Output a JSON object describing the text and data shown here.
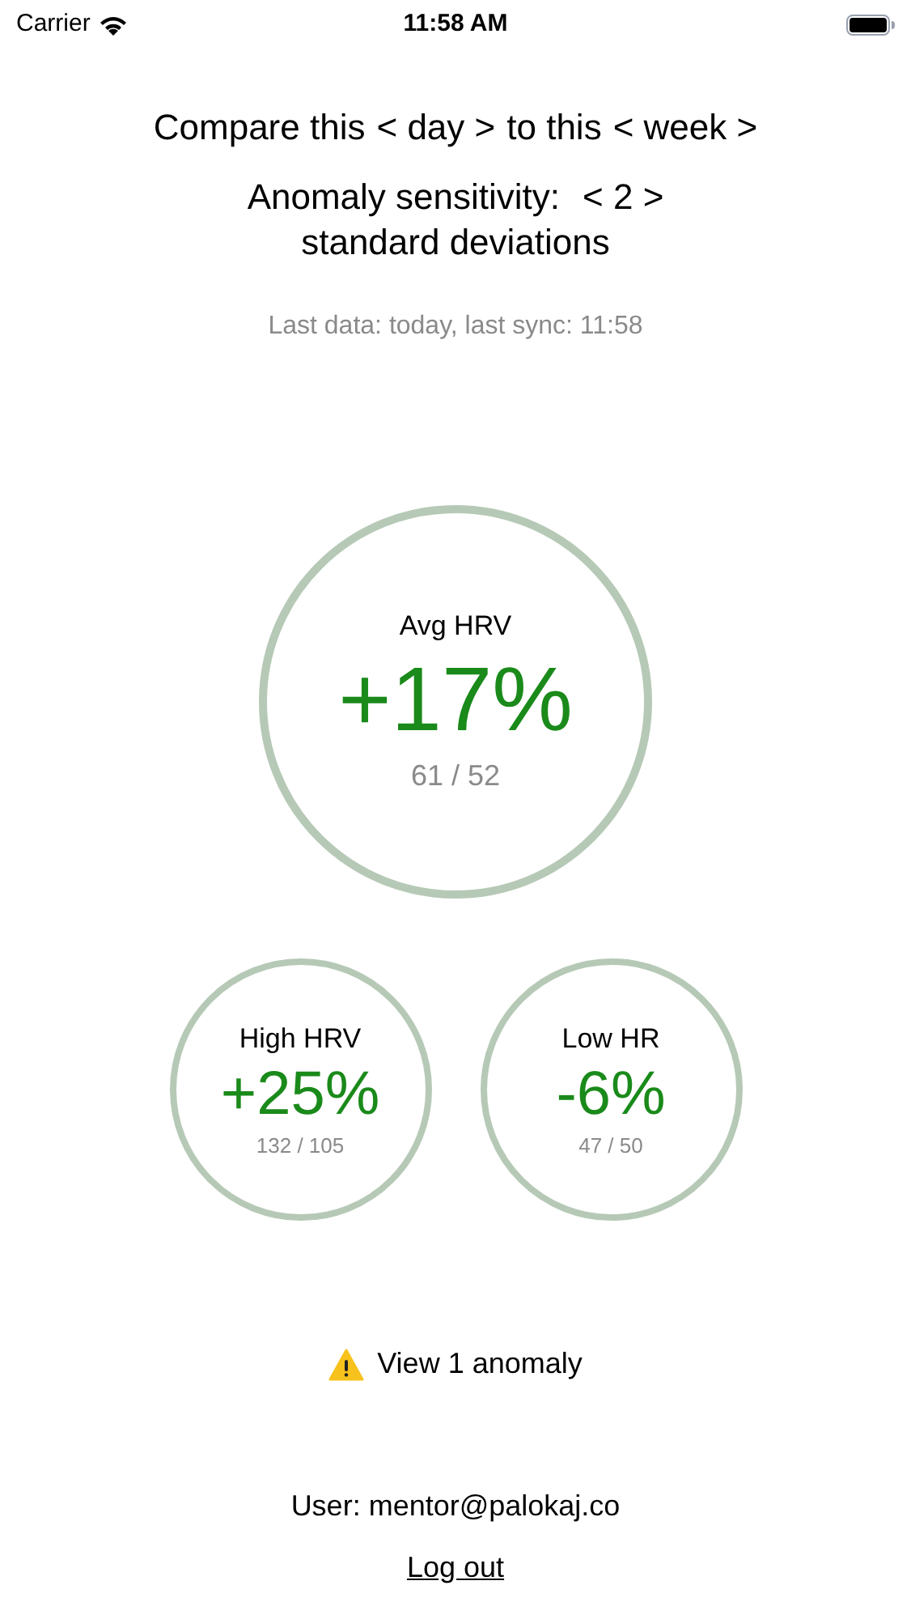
{
  "status_bar": {
    "carrier": "Carrier",
    "time": "11:58 AM"
  },
  "comparison": {
    "prefix": "Compare this",
    "period": "< day >",
    "middle": "to this",
    "baseline": "< week >"
  },
  "sensitivity": {
    "label": "Anomaly sensitivity:",
    "value": "< 2 >",
    "unit": "standard deviations"
  },
  "last_sync": "Last data: today, last sync: 11:58",
  "metrics": [
    {
      "kind": "large",
      "label": "Avg HRV",
      "change": "+17%",
      "values": "61 / 52"
    },
    {
      "kind": "small",
      "label": "High HRV",
      "change": "+25%",
      "values": "132 / 105"
    },
    {
      "kind": "small",
      "label": "Low HR",
      "change": "-6%",
      "values": "47 / 50"
    }
  ],
  "anomaly_link": "View 1 anomaly",
  "user": "User: mentor@palokaj.co",
  "logout": "Log out"
}
